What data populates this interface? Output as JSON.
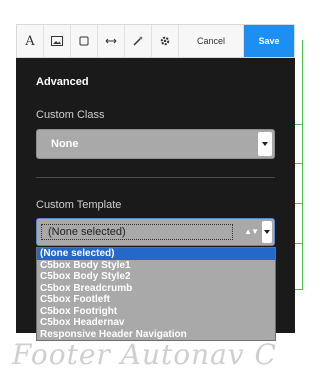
{
  "toolbar": {
    "icons": [
      "text-format-icon",
      "image-icon",
      "square-icon",
      "width-arrows-icon",
      "magic-wand-icon",
      "gear-icon"
    ],
    "text_icon_glyph": "A",
    "cancel_label": "Cancel",
    "save_label": "Save",
    "save_color": "#1f8ef1"
  },
  "panel": {
    "title": "Advanced",
    "custom_class": {
      "label": "Custom Class",
      "value": "None"
    },
    "custom_template": {
      "label": "Custom Template",
      "value": "(None selected)",
      "options": [
        "(None selected)",
        "C5box Body Style1",
        "C5box Body Style2",
        "C5box Breadcrumb",
        "C5box Footleft",
        "C5box Footright",
        "C5box Headernav",
        "Responsive Header Navigation"
      ],
      "selected_index": 0
    }
  },
  "background": {
    "footer_text": "Footer  Autonav  C",
    "accent_green": "#4cc24c"
  }
}
